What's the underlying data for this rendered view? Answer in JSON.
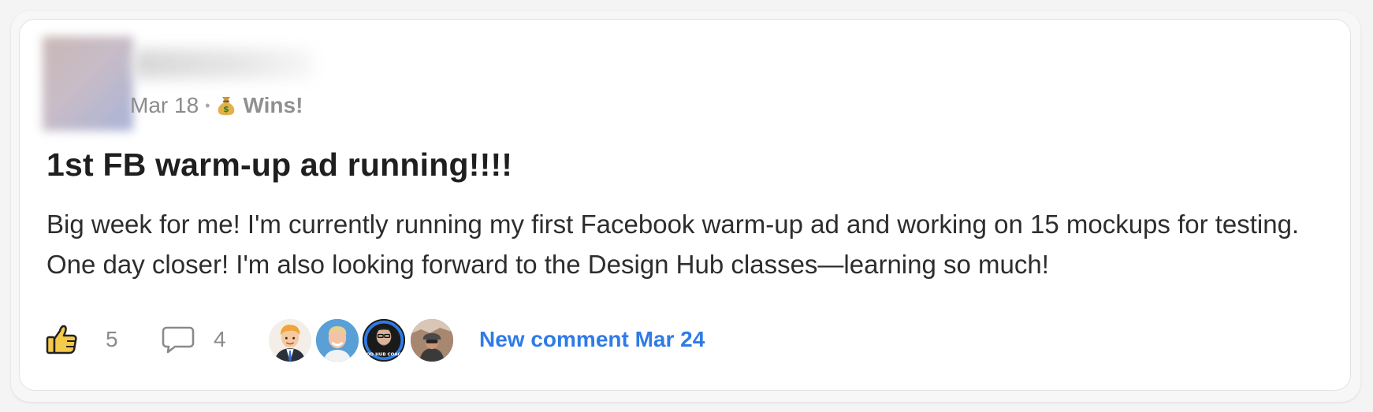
{
  "post": {
    "date": "Mar 18",
    "separator": "•",
    "category": "Wins!",
    "category_icon": "money-bag-icon",
    "title": "1st FB warm-up ad running!!!!",
    "body": "Big week for me! I'm currently running my first Facebook warm-up ad and working on 15 mockups for testing. One day closer! I'm also looking forward to the Design Hub classes—learning so much!"
  },
  "actions": {
    "like_icon": "thumbs-up-icon",
    "likes": "5",
    "comment_icon": "comment-bubble-icon",
    "comments": "4",
    "new_comment": "New comment Mar 24"
  },
  "colors": {
    "link": "#2f7be6",
    "title": "#1f1f1f",
    "muted": "#8b8b8b",
    "like_fill": "#f5c94a"
  }
}
